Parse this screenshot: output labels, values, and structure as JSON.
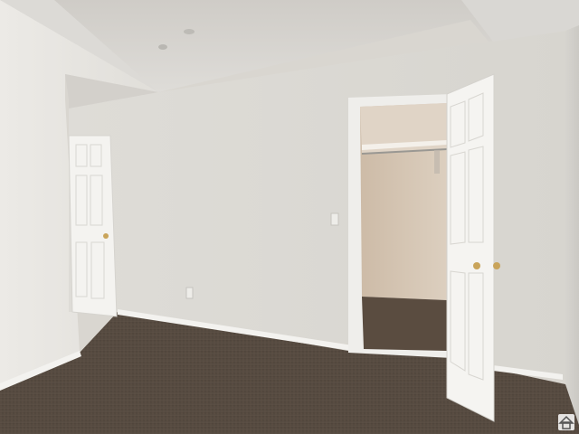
{
  "scene": {
    "description_colors": {
      "ceiling": "#d8d6d2",
      "wall_left": "#e6e4e0",
      "wall_back": "#dcdad5",
      "wall_right": "#d4d2cd",
      "closet_wall": "#d8c8b6",
      "carpet": "#5a4e44",
      "door": "#f3f2ef",
      "baseboard": "#f2f1ee",
      "hardware": "#c9a45a"
    },
    "icons": [
      "home-logo-icon",
      "smoke-detector-icon",
      "light-switch-icon",
      "outlet-icon"
    ]
  }
}
